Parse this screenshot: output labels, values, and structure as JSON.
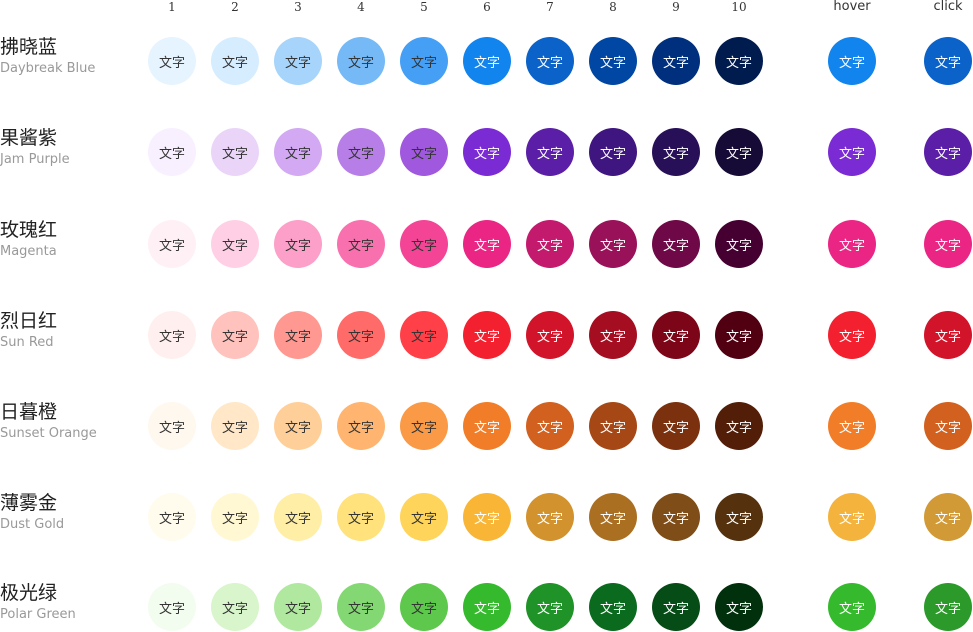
{
  "columns": [
    "1",
    "2",
    "3",
    "4",
    "5",
    "6",
    "7",
    "8",
    "9",
    "10",
    "hover",
    "click"
  ],
  "swatch_text": "文字",
  "palettes": [
    {
      "name_cn": "拂晓蓝",
      "name_en": "Daybreak Blue",
      "colors": [
        "#e6f4ff",
        "#d6edff",
        "#a6d4fa",
        "#75b9f7",
        "#449ff5",
        "#1284ee",
        "#0b62c8",
        "#0046a3",
        "#002f7d",
        "#001c4f"
      ],
      "text": [
        "#333333",
        "#333333",
        "#333333",
        "#333333",
        "#333333",
        "#ffffff",
        "#ffffff",
        "#ffffff",
        "#ffffff",
        "#ffffff"
      ],
      "hover": "#1284ee",
      "click": "#0b62c8"
    },
    {
      "name_cn": "果酱紫",
      "name_en": "Jam Purple",
      "colors": [
        "#f8efff",
        "#ead5f9",
        "#d2a9f2",
        "#b77ee8",
        "#9f58de",
        "#7a2bd3",
        "#5a1fa6",
        "#3f1580",
        "#281059",
        "#160a36"
      ],
      "text": [
        "#333333",
        "#333333",
        "#333333",
        "#333333",
        "#333333",
        "#ffffff",
        "#ffffff",
        "#ffffff",
        "#ffffff",
        "#ffffff"
      ],
      "hover": "#7a2bd3",
      "click": "#5a1fa6"
    },
    {
      "name_cn": "玫瑰红",
      "name_en": "Magenta",
      "colors": [
        "#fff0f6",
        "#ffd0e5",
        "#fc9fc9",
        "#f871ae",
        "#f34496",
        "#eb2584",
        "#c31a6e",
        "#981159",
        "#6f0846",
        "#450031"
      ],
      "text": [
        "#333333",
        "#333333",
        "#333333",
        "#333333",
        "#333333",
        "#ffffff",
        "#ffffff",
        "#ffffff",
        "#ffffff",
        "#ffffff"
      ],
      "hover": "#eb2584",
      "click": "#eb2584"
    },
    {
      "name_cn": "烈日红",
      "name_en": "Sun Red",
      "colors": [
        "#fff0ef",
        "#ffc2bd",
        "#ff9891",
        "#ff6b68",
        "#ff4048",
        "#f3212f",
        "#d1142a",
        "#a50d21",
        "#7c0618",
        "#500010"
      ],
      "text": [
        "#333333",
        "#333333",
        "#333333",
        "#333333",
        "#333333",
        "#ffffff",
        "#ffffff",
        "#ffffff",
        "#ffffff",
        "#ffffff"
      ],
      "hover": "#f3212f",
      "click": "#d1142a"
    },
    {
      "name_cn": "日暮橙",
      "name_en": "Sunset Orange",
      "colors": [
        "#fff8ee",
        "#ffe7c7",
        "#ffcf9a",
        "#ffb56f",
        "#fa9946",
        "#f27d28",
        "#d2601f",
        "#a64716",
        "#7c310e",
        "#521e07"
      ],
      "text": [
        "#333333",
        "#333333",
        "#333333",
        "#333333",
        "#333333",
        "#ffffff",
        "#ffffff",
        "#ffffff",
        "#ffffff",
        "#ffffff"
      ],
      "hover": "#f27d28",
      "click": "#d2601f"
    },
    {
      "name_cn": "薄雾金",
      "name_en": "Dust Gold",
      "colors": [
        "#fffcee",
        "#fff8d2",
        "#ffeea6",
        "#ffe27c",
        "#ffd45a",
        "#f9b636",
        "#d2922d",
        "#ab6f22",
        "#7f4d17",
        "#55310d"
      ],
      "text": [
        "#333333",
        "#333333",
        "#333333",
        "#333333",
        "#333333",
        "#ffffff",
        "#ffffff",
        "#ffffff",
        "#ffffff",
        "#ffffff"
      ],
      "hover": "#f3b33c",
      "click": "#d29a36"
    },
    {
      "name_cn": "极光绿",
      "name_en": "Polar Green",
      "colors": [
        "#f3fdef",
        "#d8f5cb",
        "#b0e8a0",
        "#84d873",
        "#5ec84c",
        "#35ba2e",
        "#1f9228",
        "#0a6b1f",
        "#054c16",
        "#01300c"
      ],
      "text": [
        "#333333",
        "#333333",
        "#333333",
        "#333333",
        "#333333",
        "#ffffff",
        "#ffffff",
        "#ffffff",
        "#ffffff",
        "#ffffff"
      ],
      "hover": "#35ba2e",
      "click": "#2c9a2a"
    }
  ]
}
